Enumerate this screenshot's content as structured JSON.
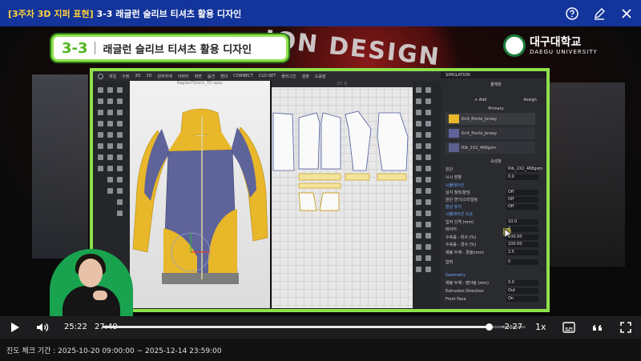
{
  "header": {
    "tag": "[3주차 3D 지퍼 표현]",
    "title": "3-3 래글런 슬리브 티셔츠 활용 디자인",
    "icons": [
      "help-icon",
      "edit-icon",
      "close-icon"
    ]
  },
  "video": {
    "chapter_number": "3-3",
    "chapter_title": "래글런 슬리브 티셔츠 활용 디자인",
    "background_text": "ION DESIGN",
    "logo_ko": "대구대학교",
    "logo_en": "DAEGU UNIVERSITY",
    "app": {
      "menu": [
        "파일",
        "수정",
        "3D",
        "2D",
        "원부자재",
        "아바타",
        "화면",
        "옵션",
        "렌더",
        "CONNECT",
        "CLO-SET",
        "플러그인",
        "설정",
        "도움말"
      ],
      "file_name": "RaglanTShirts_TD.zpac",
      "view_2d_title": "2D 창",
      "panel": {
        "simulation": "SIMULATION",
        "object_browser": "물체창",
        "add": "+ Add",
        "assign": "Assign",
        "primary": "Primary",
        "fabrics": [
          {
            "name": "Knit_Ponte_Jersey",
            "color": "#e8b72a"
          },
          {
            "name": "Knit_Ponte_Jersey",
            "color": "#5e6399"
          },
          {
            "name": "Rib_2X2_468gsm",
            "color": "#5c608f"
          }
        ],
        "property_editor": "속성창",
        "fabric_label": "원단",
        "fabric_value": "Rib_2X2_468gsm",
        "seam_label": "시시 방향",
        "seam_value": "0.0",
        "sim_group": "시뮬레이션",
        "sim_rows": [
          {
            "label": "심지 첨착/분딩",
            "value": "Off"
          },
          {
            "label": "원단 연기/스타일링",
            "value": "Off"
          }
        ],
        "strengthen_label": "형상 유지",
        "strengthen_value": "Off",
        "particle_group": "시뮬레이션 속성",
        "particle_rows": [
          {
            "label": "입자 간격 (mm)",
            "value": "10.0"
          },
          {
            "label": "레이어",
            "value": "0"
          },
          {
            "label": "수축률 - 위사 (%)",
            "value": "100.00"
          },
          {
            "label": "수축률 - 경사 (%)",
            "value": "100.00"
          },
          {
            "label": "재봉 두께 - 경울(mm)",
            "value": "2.5"
          }
        ],
        "pressure_label": "압력",
        "pressure_value": "0",
        "geometry": "Geometry",
        "geometry_rows": [
          {
            "label": "재봉 두께 - 렌더링 (mm)",
            "value": "0.0"
          },
          {
            "label": "Extrusion Direction",
            "value": "Out"
          },
          {
            "label": "Front Face",
            "value": "On"
          }
        ]
      }
    }
  },
  "controls": {
    "current_time": "25:22",
    "duration": "27:49",
    "remaining": "-2:27",
    "speed": "1x",
    "progress": 0.912,
    "icons": [
      "play-icon",
      "volume-icon",
      "subtitles-icon",
      "quote-icon",
      "fullscreen-icon"
    ]
  },
  "footer": {
    "period": "진도 체크 기간 : 2025-10-20 09:00:00 ~ 2025-12-14 23:59:00"
  },
  "colors": {
    "header_bg": "#13349a",
    "accent_green": "#8ee14b",
    "garment_yellow": "#e8b72a",
    "garment_blue": "#5e6399"
  }
}
